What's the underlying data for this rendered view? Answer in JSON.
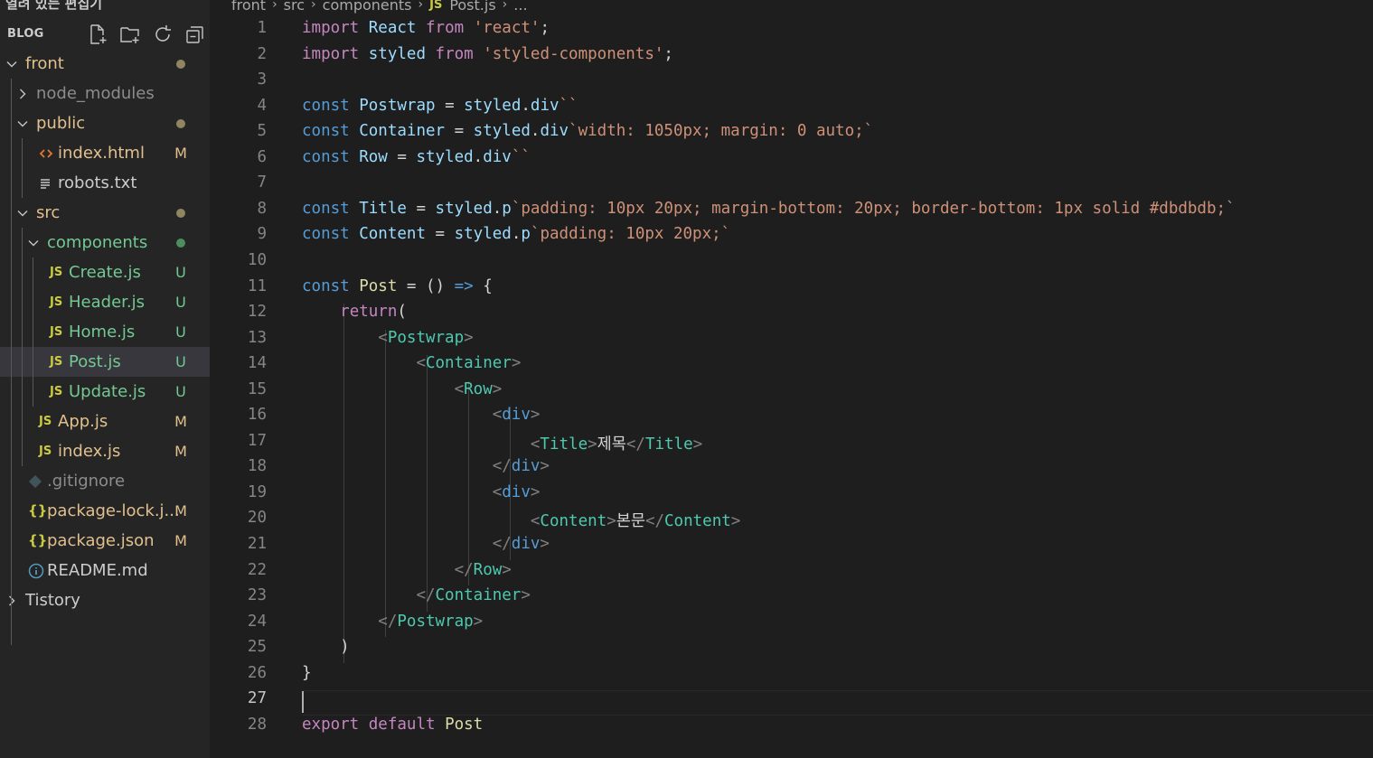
{
  "sidebar": {
    "title": "열려 있는 편집기",
    "section_label": "BLOG",
    "actions": [
      {
        "icon": "new-file-icon"
      },
      {
        "icon": "new-folder-icon"
      },
      {
        "icon": "refresh-icon"
      },
      {
        "icon": "collapse-all-icon"
      }
    ],
    "tree": [
      {
        "label": "front",
        "kind": "folder",
        "expanded": true,
        "status": "dot"
      },
      {
        "label": "node_modules",
        "kind": "folder",
        "expanded": false
      },
      {
        "label": "public",
        "kind": "folder",
        "expanded": true,
        "status": "dot"
      },
      {
        "label": "index.html",
        "kind": "html-file",
        "badge": "M"
      },
      {
        "label": "robots.txt",
        "kind": "text-file"
      },
      {
        "label": "src",
        "kind": "folder",
        "expanded": true,
        "status": "dot"
      },
      {
        "label": "components",
        "kind": "folder",
        "expanded": true,
        "status": "dot"
      },
      {
        "label": "Create.js",
        "kind": "js-file",
        "badge": "U"
      },
      {
        "label": "Header.js",
        "kind": "js-file",
        "badge": "U"
      },
      {
        "label": "Home.js",
        "kind": "js-file",
        "badge": "U"
      },
      {
        "label": "Post.js",
        "kind": "js-file",
        "badge": "U",
        "selected": true
      },
      {
        "label": "Update.js",
        "kind": "js-file",
        "badge": "U"
      },
      {
        "label": "App.js",
        "kind": "js-file",
        "badge": "M"
      },
      {
        "label": "index.js",
        "kind": "js-file",
        "badge": "M"
      },
      {
        "label": ".gitignore",
        "kind": "git-file"
      },
      {
        "label": "package-lock.j...",
        "kind": "json-file",
        "badge": "M"
      },
      {
        "label": "package.json",
        "kind": "json-file",
        "badge": "M"
      },
      {
        "label": "README.md",
        "kind": "info-file"
      },
      {
        "label": "Tistory",
        "kind": "folder",
        "expanded": false
      }
    ],
    "js_icon_text": "JS",
    "json_icon_text": "{}",
    "colors": {
      "untracked": "#73c991",
      "modified": "#e2c08d",
      "ignored": "#8c8c8c",
      "default": "#cccccc",
      "dot_modified": "#8f8561",
      "dot_untracked": "#4e8d5e"
    }
  },
  "breadcrumb": {
    "items": [
      "front",
      "src",
      "components",
      "Post.js",
      "..."
    ],
    "file_icon_text": "JS"
  },
  "editor": {
    "active_line": 27,
    "lines": [
      [
        [
          "kwc",
          "import"
        ],
        [
          "txt",
          " "
        ],
        [
          "var",
          "React"
        ],
        [
          "txt",
          " "
        ],
        [
          "kwc",
          "from"
        ],
        [
          "txt",
          " "
        ],
        [
          "str",
          "'react'"
        ],
        [
          "txt",
          ";"
        ]
      ],
      [
        [
          "kwc",
          "import"
        ],
        [
          "txt",
          " "
        ],
        [
          "var",
          "styled"
        ],
        [
          "txt",
          " "
        ],
        [
          "kwc",
          "from"
        ],
        [
          "txt",
          " "
        ],
        [
          "str",
          "'styled-components'"
        ],
        [
          "txt",
          ";"
        ]
      ],
      [],
      [
        [
          "kw",
          "const"
        ],
        [
          "txt",
          " "
        ],
        [
          "var",
          "Postwrap"
        ],
        [
          "txt",
          " = "
        ],
        [
          "var",
          "styled"
        ],
        [
          "txt",
          "."
        ],
        [
          "var",
          "div"
        ],
        [
          "str",
          "``"
        ]
      ],
      [
        [
          "kw",
          "const"
        ],
        [
          "txt",
          " "
        ],
        [
          "var",
          "Container"
        ],
        [
          "txt",
          " = "
        ],
        [
          "var",
          "styled"
        ],
        [
          "txt",
          "."
        ],
        [
          "var",
          "div"
        ],
        [
          "str",
          "`width: 1050px; margin: 0 auto;`"
        ]
      ],
      [
        [
          "kw",
          "const"
        ],
        [
          "txt",
          " "
        ],
        [
          "var",
          "Row"
        ],
        [
          "txt",
          " = "
        ],
        [
          "var",
          "styled"
        ],
        [
          "txt",
          "."
        ],
        [
          "var",
          "div"
        ],
        [
          "str",
          "``"
        ]
      ],
      [],
      [
        [
          "kw",
          "const"
        ],
        [
          "txt",
          " "
        ],
        [
          "var",
          "Title"
        ],
        [
          "txt",
          " = "
        ],
        [
          "var",
          "styled"
        ],
        [
          "txt",
          "."
        ],
        [
          "var",
          "p"
        ],
        [
          "str",
          "`padding: 10px 20px; margin-bottom: 20px; border-bottom: 1px solid #dbdbdb;`"
        ]
      ],
      [
        [
          "kw",
          "const"
        ],
        [
          "txt",
          " "
        ],
        [
          "var",
          "Content"
        ],
        [
          "txt",
          " = "
        ],
        [
          "var",
          "styled"
        ],
        [
          "txt",
          "."
        ],
        [
          "var",
          "p"
        ],
        [
          "str",
          "`padding: 10px 20px;`"
        ]
      ],
      [],
      [
        [
          "kw",
          "const"
        ],
        [
          "txt",
          " "
        ],
        [
          "fn",
          "Post"
        ],
        [
          "txt",
          " = () "
        ],
        [
          "kw",
          "=>"
        ],
        [
          "txt",
          " {"
        ]
      ],
      [
        [
          "txt",
          "    "
        ],
        [
          "kwc",
          "return"
        ],
        [
          "txt",
          "("
        ]
      ],
      [
        [
          "txt",
          "        "
        ],
        [
          "br",
          "<"
        ],
        [
          "tag",
          "Postwrap"
        ],
        [
          "br",
          ">"
        ]
      ],
      [
        [
          "txt",
          "            "
        ],
        [
          "br",
          "<"
        ],
        [
          "tag",
          "Container"
        ],
        [
          "br",
          ">"
        ]
      ],
      [
        [
          "txt",
          "                "
        ],
        [
          "br",
          "<"
        ],
        [
          "tag",
          "Row"
        ],
        [
          "br",
          ">"
        ]
      ],
      [
        [
          "txt",
          "                    "
        ],
        [
          "br",
          "<"
        ],
        [
          "kw",
          "div"
        ],
        [
          "br",
          ">"
        ]
      ],
      [
        [
          "txt",
          "                        "
        ],
        [
          "br",
          "<"
        ],
        [
          "tag",
          "Title"
        ],
        [
          "br",
          ">"
        ],
        [
          "txt",
          "제목"
        ],
        [
          "br",
          "</"
        ],
        [
          "tag",
          "Title"
        ],
        [
          "br",
          ">"
        ]
      ],
      [
        [
          "txt",
          "                    "
        ],
        [
          "br",
          "</"
        ],
        [
          "kw",
          "div"
        ],
        [
          "br",
          ">"
        ]
      ],
      [
        [
          "txt",
          "                    "
        ],
        [
          "br",
          "<"
        ],
        [
          "kw",
          "div"
        ],
        [
          "br",
          ">"
        ]
      ],
      [
        [
          "txt",
          "                        "
        ],
        [
          "br",
          "<"
        ],
        [
          "tag",
          "Content"
        ],
        [
          "br",
          ">"
        ],
        [
          "txt",
          "본문"
        ],
        [
          "br",
          "</"
        ],
        [
          "tag",
          "Content"
        ],
        [
          "br",
          ">"
        ]
      ],
      [
        [
          "txt",
          "                    "
        ],
        [
          "br",
          "</"
        ],
        [
          "kw",
          "div"
        ],
        [
          "br",
          ">"
        ]
      ],
      [
        [
          "txt",
          "                "
        ],
        [
          "br",
          "</"
        ],
        [
          "tag",
          "Row"
        ],
        [
          "br",
          ">"
        ]
      ],
      [
        [
          "txt",
          "            "
        ],
        [
          "br",
          "</"
        ],
        [
          "tag",
          "Container"
        ],
        [
          "br",
          ">"
        ]
      ],
      [
        [
          "txt",
          "        "
        ],
        [
          "br",
          "</"
        ],
        [
          "tag",
          "Postwrap"
        ],
        [
          "br",
          ">"
        ]
      ],
      [
        [
          "txt",
          "    )"
        ]
      ],
      [
        [
          "txt",
          "}"
        ]
      ],
      [],
      [
        [
          "kwc",
          "export"
        ],
        [
          "txt",
          " "
        ],
        [
          "kwc",
          "default"
        ],
        [
          "txt",
          " "
        ],
        [
          "fn",
          "Post"
        ]
      ]
    ]
  }
}
